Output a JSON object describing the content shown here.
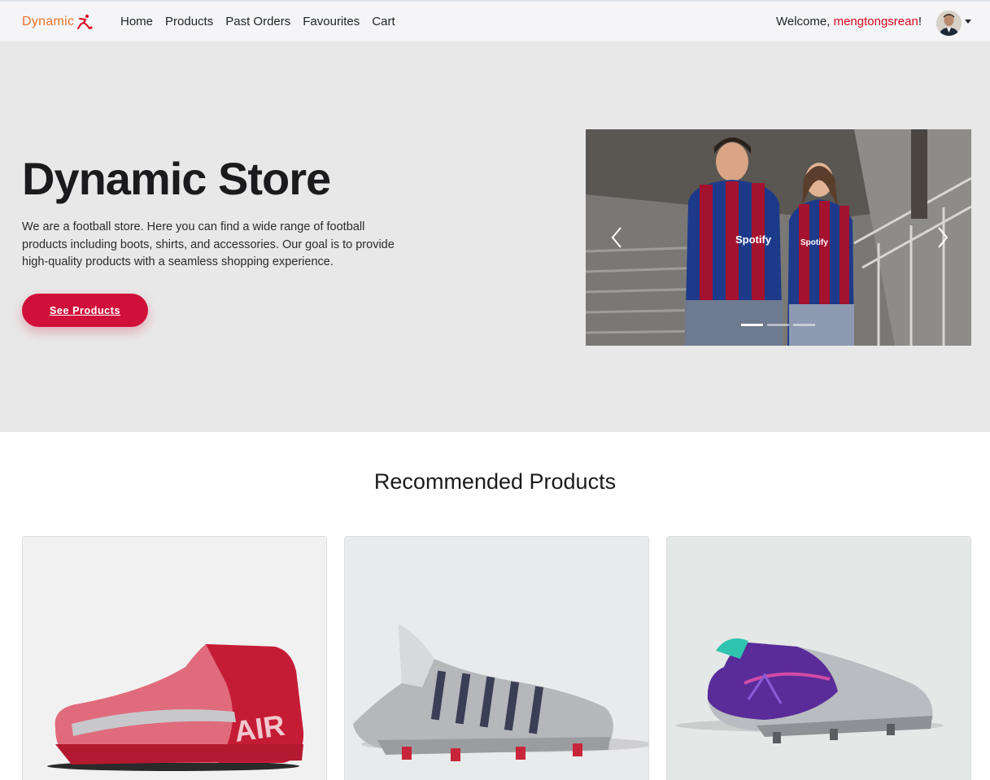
{
  "brand": {
    "name": "Dynamic",
    "accent": "#e8742a",
    "logo_color": "#d8091f"
  },
  "nav": {
    "links": [
      {
        "label": "Home"
      },
      {
        "label": "Products"
      },
      {
        "label": "Past Orders"
      },
      {
        "label": "Favourites"
      },
      {
        "label": "Cart"
      }
    ],
    "welcome_prefix": "Welcome, ",
    "username": "mengtongsrean",
    "welcome_suffix": "!",
    "user_menu_icon": "caret-down-icon"
  },
  "hero": {
    "title": "Dynamic Store",
    "description": "We are a football store. Here you can find a wide range of football products including boots, shirts, and accessories. Our goal is to provide high-quality products with a seamless shopping experience.",
    "cta_label": "See Products",
    "cta_color": "#d0103a",
    "carousel": {
      "slide_count": 3,
      "active_index": 0,
      "prev_icon": "chevron-left-icon",
      "next_icon": "chevron-right-icon",
      "slide_text": [
        "Spotify",
        "Spotify"
      ]
    }
  },
  "recommended": {
    "title": "Recommended Products",
    "products": [
      {
        "image": "red-pink-football-boot",
        "boot_text": "AIR"
      },
      {
        "image": "silver-spiked-football-boot"
      },
      {
        "image": "silver-purple-football-boot"
      }
    ]
  }
}
